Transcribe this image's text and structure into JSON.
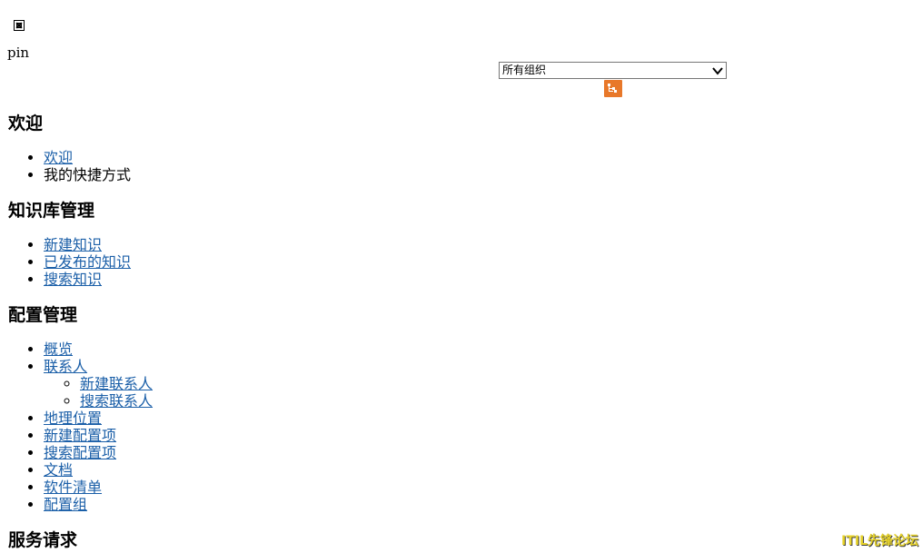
{
  "top": {
    "pin_label": "pin",
    "org_select_value": "所有组织"
  },
  "sections": [
    {
      "title": "欢迎",
      "items": [
        {
          "label": "欢迎",
          "link": true
        },
        {
          "label": "我的快捷方式",
          "link": false
        }
      ]
    },
    {
      "title": "知识库管理",
      "items": [
        {
          "label": "新建知识",
          "link": true
        },
        {
          "label": "已发布的知识",
          "link": true
        },
        {
          "label": "搜索知识",
          "link": true
        }
      ]
    },
    {
      "title": "配置管理",
      "items": [
        {
          "label": "概览",
          "link": true
        },
        {
          "label": "联系人",
          "link": true
        },
        {
          "label": "新建联系人",
          "link": true
        },
        {
          "label": "搜索联系人",
          "link": true
        },
        {
          "label": "地理位置",
          "link": true
        },
        {
          "label": "新建配置项",
          "link": true
        },
        {
          "label": "搜索配置项",
          "link": true
        },
        {
          "label": "文档",
          "link": true
        },
        {
          "label": "软件清单",
          "link": true
        },
        {
          "label": "配置组",
          "link": true
        }
      ]
    },
    {
      "title": "服务请求",
      "items": []
    }
  ],
  "watermark": "ITIL先锋论坛",
  "colors": {
    "link": "#1b5fa8",
    "tree_button": "#e8782a",
    "watermark": "#e6d22a"
  }
}
